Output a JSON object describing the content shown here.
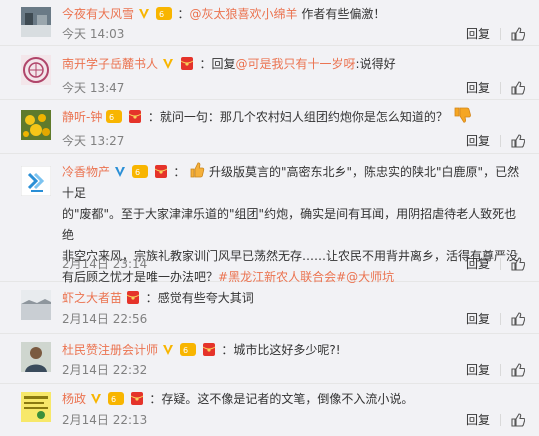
{
  "comments": [
    {
      "name": "今夜有大风雪",
      "colon": "：",
      "mention": "@灰太狼喜欢小绵羊",
      "body": " 作者有些偏激！",
      "time": "今天 14:03",
      "reply": "回复"
    },
    {
      "name": "南开学子岳麓书人",
      "colon": "：",
      "reply_prefix": "回复",
      "mention": "@可是我只有十一岁呀",
      "body": ":说得好",
      "time": "今天 13:47",
      "reply": "回复"
    },
    {
      "name": "静听-钟",
      "colon": "：",
      "body": "就问一句：那几个农村妇人组团约炮你是怎么知道的？",
      "time": "今天 13:27",
      "reply": "回复"
    },
    {
      "name": "冷香物产",
      "colon": "：",
      "line1": "升级版莫言的\"高密东北乡\"，陈忠实的陕北\"白鹿原\"，已然十足",
      "line2": "的\"废都\"。至于大家津津乐道的\"组团\"约炮，确实是间有耳闻，用阴招虐待老人致死也绝",
      "line3": "非空穴来风，宗族礼教家训门风早已荡然无存……让农民不用背井离乡，活得有尊严没",
      "line4": "有后顾之忧才是唯一办法吧？",
      "topic": "#黑龙江新农人联合会#",
      "mention": "@大师坑",
      "time": "2月14日 23:14",
      "reply": "回复"
    },
    {
      "name": "虾之大者苗",
      "colon": "：",
      "body": "感觉有些夸大其词",
      "time": "2月14日 22:56",
      "reply": "回复"
    },
    {
      "name": "杜民赞注册会计师",
      "colon": "：",
      "body": "城市比这好多少呢?!",
      "time": "2月14日 22:32",
      "reply": "回复"
    },
    {
      "name": "杨政",
      "colon": "：",
      "body": "存疑。这不像是记者的文笔，倒像不入流小说。",
      "time": "2月14日 22:13",
      "reply": "回复"
    }
  ],
  "colors": {
    "name": "#eb7350",
    "time": "#808080",
    "background": "#f2f2f5"
  },
  "icons": [
    "verified-v-icon",
    "vip-icon",
    "red-packet-icon",
    "thumbs-up-icon",
    "thumbs-down-emoji-icon",
    "like-thumb-icon"
  ]
}
